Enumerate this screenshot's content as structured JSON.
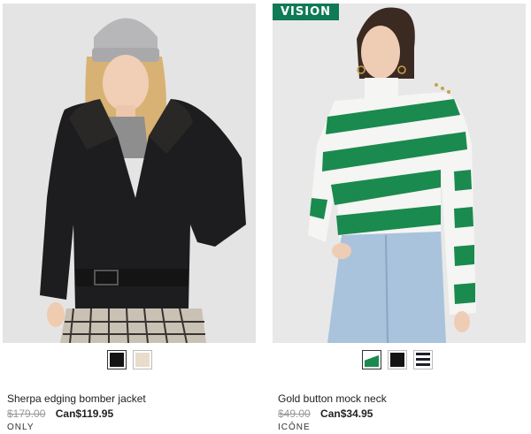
{
  "products": [
    {
      "name": "Sherpa edging bomber jacket",
      "old_price": "$179.00",
      "new_price": "Can$119.95",
      "brand": "ONLY",
      "swatches": [
        {
          "color": "#141414",
          "selected": true
        },
        {
          "color": "#e9dccb",
          "selected": false
        }
      ]
    },
    {
      "badge": "VISION",
      "name": "Gold button mock neck",
      "old_price": "$49.00",
      "new_price": "Can$34.95",
      "brand": "ICÔNE",
      "swatches": [
        {
          "color": "#1a8a4e",
          "selected": true
        },
        {
          "color": "#141414",
          "selected": false
        },
        {
          "color": "striped-navy-white",
          "selected": false
        }
      ]
    }
  ]
}
